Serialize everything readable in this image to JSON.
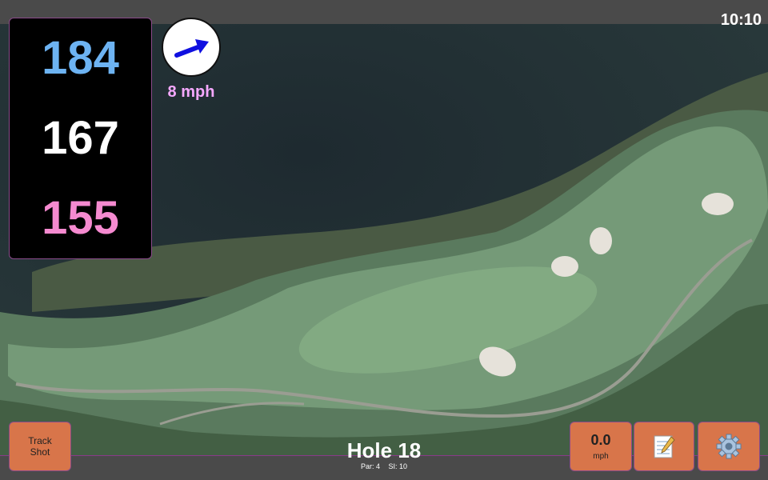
{
  "clock": "10:10",
  "distances": {
    "back": "184",
    "middle": "167",
    "front": "155"
  },
  "wind": {
    "speed": "8 mph",
    "direction_icon": "wind-arrow-icon"
  },
  "hole": {
    "title": "Hole 18",
    "par": "Par: 4",
    "stroke_index": "SI: 10"
  },
  "buttons": {
    "track_shot": "Track Shot",
    "speed_value": "0.0",
    "speed_unit": "mph",
    "notes_icon": "notepad-icon",
    "settings_icon": "gear-icon"
  },
  "colors": {
    "back": "#6db3f2",
    "middle": "#ffffff",
    "front": "#f58ad0",
    "button": "#d8754a",
    "accent_border": "#8a3a8a"
  }
}
